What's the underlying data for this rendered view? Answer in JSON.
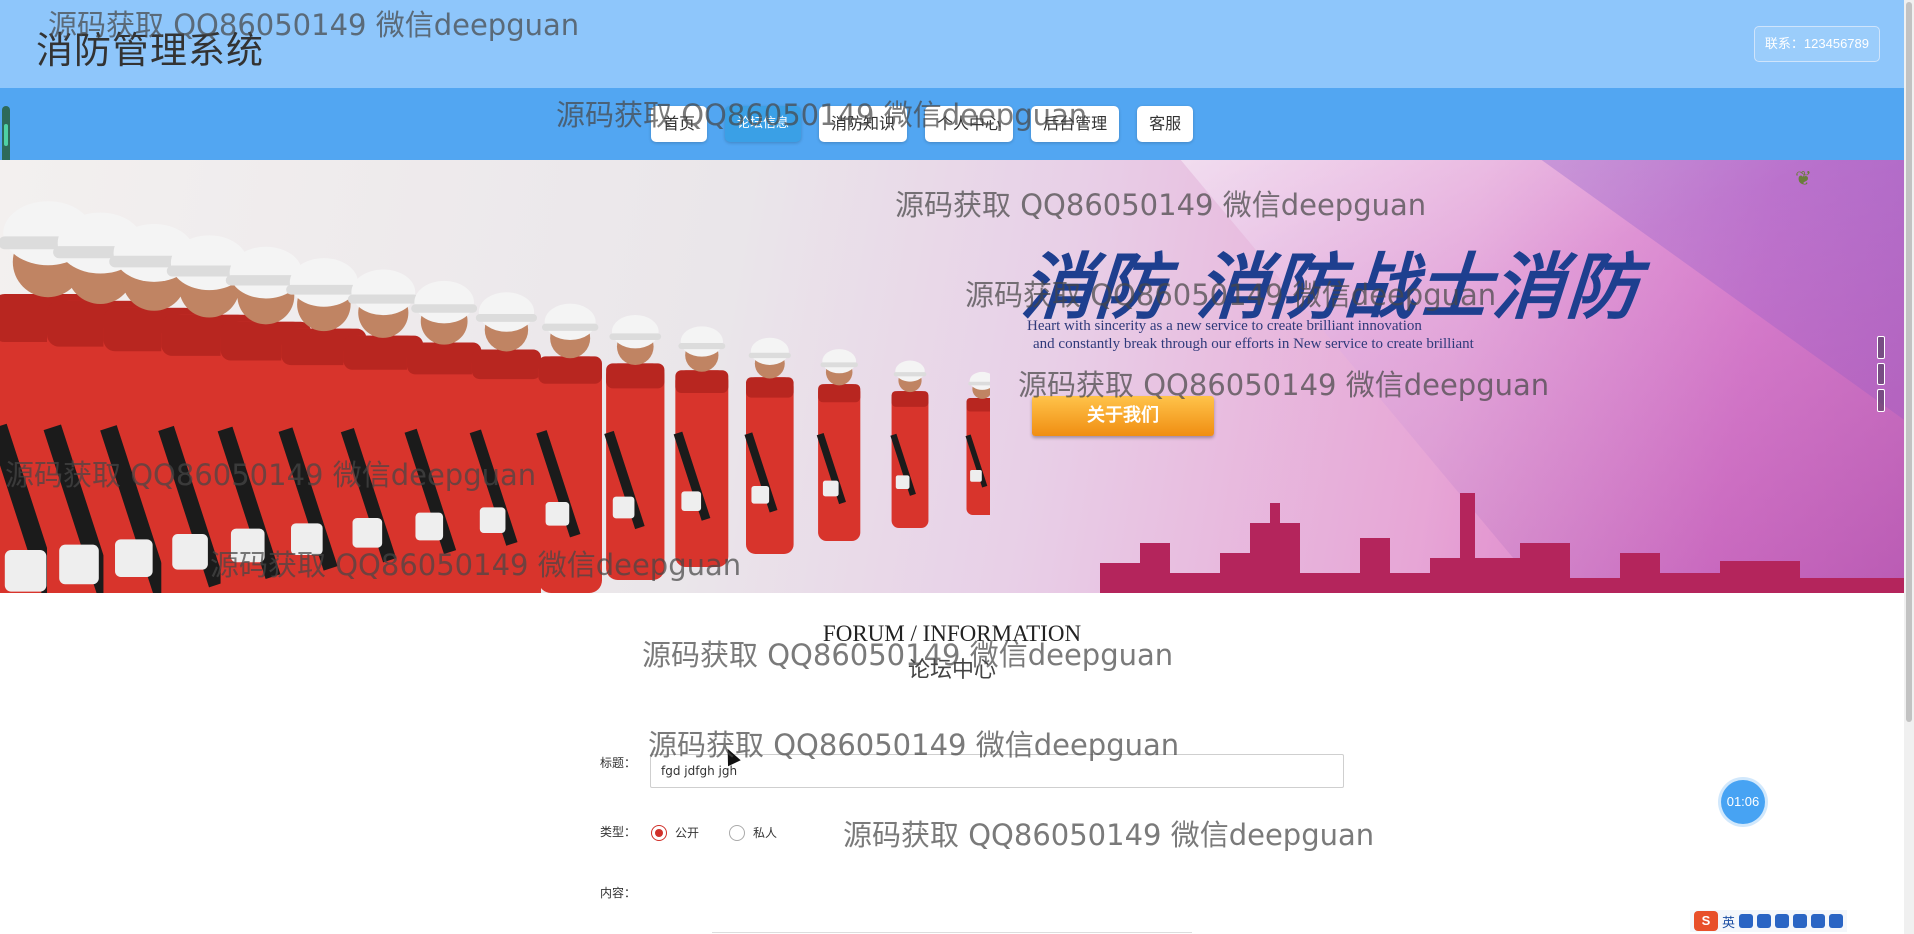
{
  "header": {
    "title": "消防管理系统",
    "contact": "联系：123456789"
  },
  "nav": {
    "items": [
      {
        "label": "首页",
        "active": false
      },
      {
        "label": "论坛信息",
        "active": true
      },
      {
        "label": "消防知识",
        "active": false
      },
      {
        "label": "个人中心",
        "active": false
      },
      {
        "label": "后台管理",
        "active": false
      },
      {
        "label": "客服",
        "active": false
      }
    ]
  },
  "banner": {
    "headline": "消防  消防战士消防",
    "subtitle_line1": "Heart with sincerity as a new service to create brilliant innovation",
    "subtitle_line2": "and constantly break through our efforts in New service to create brilliant",
    "button_label": "关于我们"
  },
  "section": {
    "title_en": "FORUM / INFORMATION",
    "title_cn": "论坛中心"
  },
  "form": {
    "title_label": "标题：",
    "title_value": "fgd jdfgh jgh",
    "type_label": "类型：",
    "type_options": [
      "公开",
      "私人"
    ],
    "type_selected": "公开",
    "content_label": "内容："
  },
  "timer": "01:06",
  "ime": {
    "lang": "英"
  },
  "watermark_text": "源码获取 QQ86050149 微信deepguan",
  "colors": {
    "header_bg": "#8ec6fb",
    "nav_bg": "#52a6f2",
    "active_tab": "#3aa0e6",
    "radio_checked": "#d0302a",
    "timer_bg": "#47a3f3"
  }
}
